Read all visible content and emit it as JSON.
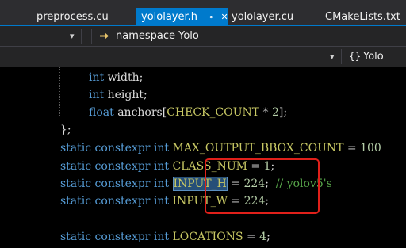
{
  "tabs": [
    {
      "label": "preprocess.cu",
      "active": false
    },
    {
      "label": "yololayer.h",
      "active": true
    },
    {
      "label": "yololayer.cu",
      "active": false
    },
    {
      "label": "CMakeLists.txt",
      "active": false
    }
  ],
  "tab_controls": {
    "pin": "⊸",
    "close": "✕"
  },
  "nav": {
    "scope_dropdown_icon": "chevron-down-icon",
    "namespace_label": "namespace Yolo",
    "member_label": "Yolo",
    "member_icon_glyph": "{}"
  },
  "code": {
    "lines": {
      "l1": {
        "kw": "int",
        "id": " width;"
      },
      "l2": {
        "kw": "int",
        "id": " height;"
      },
      "l3": {
        "kw": "float",
        "id": " anchors[",
        "mac": "CHECK_COUNT",
        "op": " * ",
        "num": "2",
        "end": "];"
      },
      "l4": {
        "text": "};"
      },
      "l5": {
        "kw": "static constexpr int",
        "mac": " MAX_OUTPUT_BBOX_COUNT",
        "op": " = ",
        "num": "100"
      },
      "l6": {
        "kw": "static constexpr int",
        "mac": " CLASS_NUM",
        "op": " = ",
        "num": "1",
        "end": ";"
      },
      "l7": {
        "kw": "static constexpr int",
        "sp": " ",
        "mac": "INPUT_H",
        "op": " = ",
        "num": "224",
        "end": ";",
        "cmt": "  // yolov5's"
      },
      "l8": {
        "kw": "static constexpr int",
        "mac": " INPUT_W",
        "op": " = ",
        "num": "224",
        "end": ";"
      },
      "l10": {
        "kw": "static constexpr int",
        "mac": " LOCATIONS",
        "op": " = ",
        "num": "4",
        "end": ";"
      }
    },
    "selected_token": "INPUT_H",
    "highlight_color": "#e0201a"
  }
}
